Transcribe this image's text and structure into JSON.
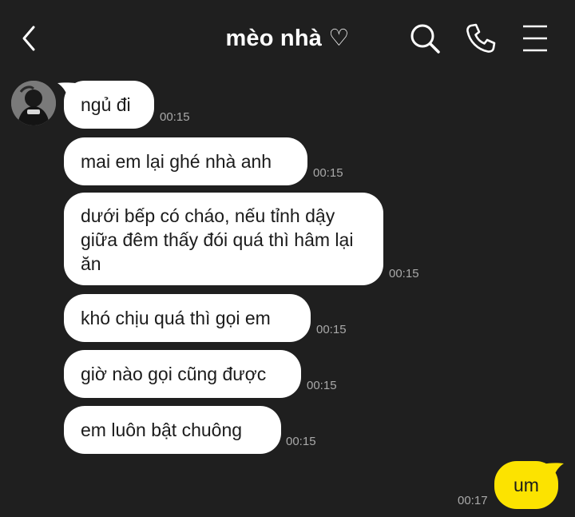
{
  "header": {
    "title": "mèo nhà ♡"
  },
  "icons": {
    "back": "chevron-left-icon",
    "search": "search-icon",
    "call": "phone-icon",
    "menu": "hamburger-menu-icon"
  },
  "colors": {
    "background": "#1f1f1f",
    "incoming_bubble": "#ffffff",
    "outgoing_bubble": "#fce300",
    "timestamp": "#a9a9a9"
  },
  "messages": [
    {
      "text": "ngủ đi",
      "time": "00:15",
      "sender": "other"
    },
    {
      "text": "mai em lại ghé nhà anh",
      "time": "00:15",
      "sender": "other"
    },
    {
      "text": "dưới bếp có cháo, nếu tỉnh dậy giữa đêm thấy đói quá thì hâm lại ăn",
      "time": "00:15",
      "sender": "other"
    },
    {
      "text": "khó chịu quá thì gọi em",
      "time": "00:15",
      "sender": "other"
    },
    {
      "text": "giờ nào gọi cũng được",
      "time": "00:15",
      "sender": "other"
    },
    {
      "text": "em luôn bật chuông",
      "time": "00:15",
      "sender": "other"
    },
    {
      "text": "um",
      "time": "00:17",
      "sender": "me"
    }
  ]
}
